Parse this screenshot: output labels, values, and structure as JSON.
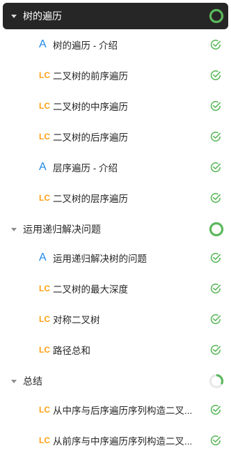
{
  "colors": {
    "accent_done": "#5cb85c",
    "lc": "#ffa116",
    "article": "#1e88e5",
    "active_bg": "#262626"
  },
  "sections": [
    {
      "title": "树的遍历",
      "active": true,
      "progress": 1.0,
      "items": [
        {
          "type": "A",
          "label": "树的遍历 - 介绍",
          "status": "check-icon"
        },
        {
          "type": "LC",
          "label": "二叉树的前序遍历",
          "status": "check-icon"
        },
        {
          "type": "LC",
          "label": "二叉树的中序遍历",
          "status": "check-icon"
        },
        {
          "type": "LC",
          "label": "二叉树的后序遍历",
          "status": "check-icon"
        },
        {
          "type": "A",
          "label": "层序遍历 - 介绍",
          "status": "check-icon"
        },
        {
          "type": "LC",
          "label": "二叉树的层序遍历",
          "status": "check-icon"
        }
      ]
    },
    {
      "title": "运用递归解决问题",
      "active": false,
      "progress": 1.0,
      "items": [
        {
          "type": "A",
          "label": "运用递归解决树的问题",
          "status": "check-icon"
        },
        {
          "type": "LC",
          "label": "二叉树的最大深度",
          "status": "check-icon"
        },
        {
          "type": "LC",
          "label": "对称二叉树",
          "status": "check-icon"
        },
        {
          "type": "LC",
          "label": "路径总和",
          "status": "check-icon"
        }
      ]
    },
    {
      "title": "总结",
      "active": false,
      "progress": 0.33,
      "items": [
        {
          "type": "LC",
          "label": "从中序与后序遍历序列构造二叉...",
          "status": "check-icon"
        },
        {
          "type": "LC",
          "label": "从前序与中序遍历序列构造二叉...",
          "status": "check-icon"
        }
      ]
    }
  ]
}
